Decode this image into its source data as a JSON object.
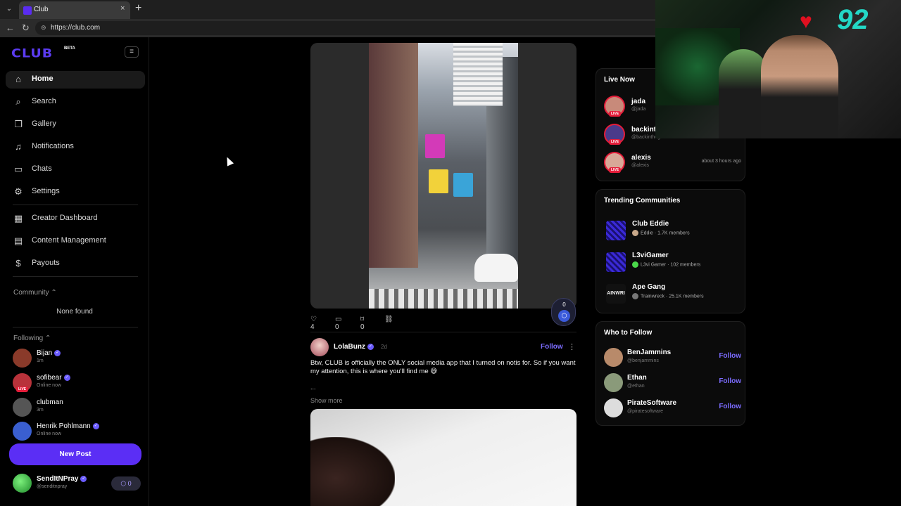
{
  "browser": {
    "tab_title": "Club",
    "tab_close": "×",
    "new_tab": "+",
    "url": "https://club.com"
  },
  "sidebar": {
    "logo": "CLUB",
    "logo_badge": "BETA",
    "nav": [
      {
        "label": "Home",
        "icon": "home-icon",
        "active": true
      },
      {
        "label": "Search",
        "icon": "search-icon"
      },
      {
        "label": "Gallery",
        "icon": "gallery-icon"
      },
      {
        "label": "Notifications",
        "icon": "bell-icon"
      },
      {
        "label": "Chats",
        "icon": "chat-icon"
      },
      {
        "label": "Settings",
        "icon": "gear-icon"
      }
    ],
    "creator_nav": [
      {
        "label": "Creator Dashboard",
        "icon": "dashboard-icon"
      },
      {
        "label": "Content Management",
        "icon": "content-icon"
      },
      {
        "label": "Payouts",
        "icon": "dollar-icon"
      }
    ],
    "community_label": "Community",
    "community_empty": "None found",
    "following_label": "Following",
    "following": [
      {
        "name": "Bijan",
        "sub": "1m",
        "verified": true,
        "live": false,
        "color": "#8a3a2a"
      },
      {
        "name": "sofibear",
        "sub": "Online now",
        "verified": true,
        "live": true,
        "color": "#b8323a"
      },
      {
        "name": "clubman",
        "sub": "3m",
        "verified": false,
        "live": false,
        "color": "#555555"
      },
      {
        "name": "Henrik Pohlmann",
        "sub": "Online now",
        "verified": true,
        "live": false,
        "color": "#3a5fd0"
      }
    ],
    "new_post": "New Post",
    "me": {
      "name": "SendItNPray",
      "handle": "@senditnpray",
      "points": "0"
    }
  },
  "feed": {
    "post1": {
      "likes": "4",
      "comments": "0",
      "bookmarks": "0",
      "tip_count": "0"
    },
    "post2": {
      "author": "LolaBunz",
      "time": "2d",
      "follow": "Follow",
      "text": "Btw, CLUB is officially the ONLY social media app that I turned on notis for. So if you want my attention, this is where you'll find me 😅",
      "ellipsis": "...",
      "show_more": "Show more"
    }
  },
  "live_now": {
    "title": "Live Now",
    "items": [
      {
        "name": "jada",
        "handle": "@jada",
        "color": "#c88a7a"
      },
      {
        "name": "backint",
        "handle": "@backinthegamerent",
        "color": "#4a3a8a"
      },
      {
        "name": "alexis",
        "handle": "@alexis",
        "time": "about 3 hours ago",
        "color": "#d8a898"
      }
    ]
  },
  "trending": {
    "title": "Trending Communities",
    "items": [
      {
        "name": "Club Eddie",
        "owner": "Eddie",
        "members": "1.7K members",
        "color": "#3a2ad8"
      },
      {
        "name": "L3viGamer",
        "owner": "L3vi Gamer",
        "members": "102 members",
        "color": "#3a2ad8"
      },
      {
        "name": "Ape Gang",
        "owner": "Trainwreck",
        "members": "25.1K members",
        "color": "#111111"
      }
    ],
    "ape_logo_text": "AINWRI"
  },
  "who_to_follow": {
    "title": "Who to Follow",
    "items": [
      {
        "name": "BenJammins",
        "handle": "@benjammins",
        "follow": "Follow",
        "color": "#b88a6a"
      },
      {
        "name": "Ethan",
        "handle": "@ethan",
        "follow": "Follow",
        "color": "#8a9a7a"
      },
      {
        "name": "PirateSoftware",
        "handle": "@piratesoftware",
        "follow": "Follow",
        "color": "#dddddd"
      }
    ]
  },
  "webcam": {
    "heart_rate": "92"
  }
}
